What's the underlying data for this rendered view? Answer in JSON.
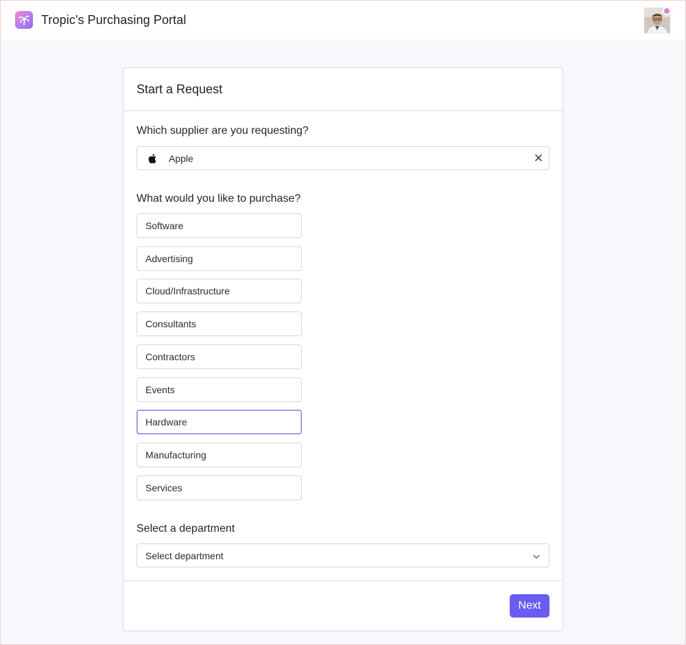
{
  "app": {
    "title": "Tropic's Purchasing Portal",
    "accent_color": "#6a5cf0",
    "logo_icon": "palm-logo-icon",
    "avatar_icon": "user-avatar"
  },
  "form": {
    "title": "Start a Request",
    "supplier": {
      "label": "Which supplier are you requesting?",
      "value": "Apple",
      "icon": "apple-icon",
      "clear_icon": "close-icon"
    },
    "purchase": {
      "label": "What would you like to purchase?",
      "options": [
        {
          "label": "Software",
          "selected": false
        },
        {
          "label": "Advertising",
          "selected": false
        },
        {
          "label": "Cloud/Infrastructure",
          "selected": false
        },
        {
          "label": "Consultants",
          "selected": false
        },
        {
          "label": "Contractors",
          "selected": false
        },
        {
          "label": "Events",
          "selected": false
        },
        {
          "label": "Hardware",
          "selected": true
        },
        {
          "label": "Manufacturing",
          "selected": false
        },
        {
          "label": "Services",
          "selected": false
        }
      ]
    },
    "department": {
      "label": "Select a department",
      "placeholder": "Select department",
      "icon": "chevron-down-icon"
    },
    "next_label": "Next"
  }
}
